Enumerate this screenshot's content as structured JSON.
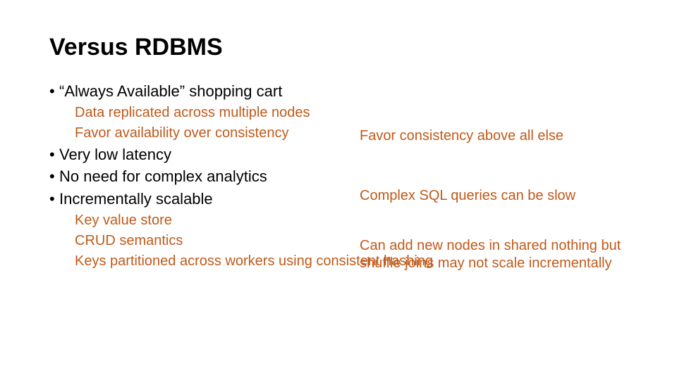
{
  "title": "Versus RDBMS",
  "b1": "“Always Available” shopping cart",
  "s1a": "Data replicated across multiple nodes",
  "s1b": "Favor availability over consistency",
  "n1": "Favor consistency above all else",
  "b2": "Very low latency",
  "b3": "No need for complex analytics",
  "n2": "Complex SQL queries can be slow",
  "b4": "Incrementally scalable",
  "s4a": "Key value store",
  "s4b": "CRUD semantics",
  "s4c": "Keys partitioned across workers using consistent hashing",
  "n3": "Can add new nodes in shared nothing but shuffle joins may not scale incrementally"
}
